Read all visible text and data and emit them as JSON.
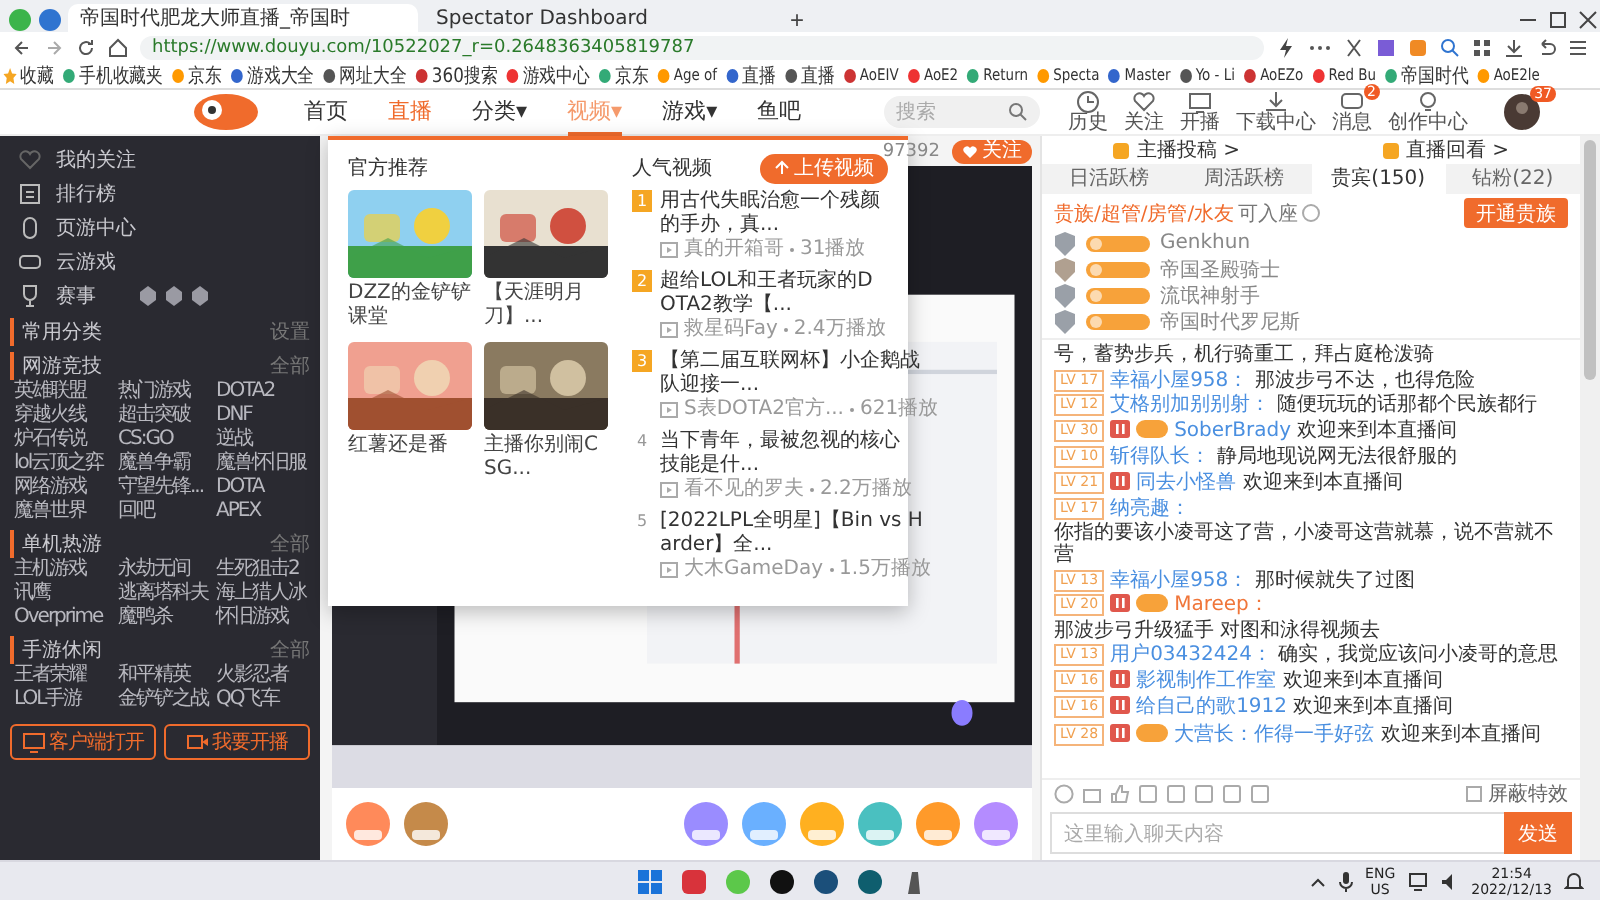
{
  "browser": {
    "tabs": [
      {
        "title": "帝国时代肥龙大师直播_帝国时",
        "selected": true
      },
      {
        "title": "Spectator Dashboard",
        "selected": false
      }
    ],
    "new_tab": "+",
    "url": "https://www.douyu.com/10522027_r=0.2648363405819787",
    "bookmarks": [
      {
        "label": "收藏"
      },
      {
        "label": "手机收藏夹"
      },
      {
        "label": "京东"
      },
      {
        "label": "游戏大全"
      },
      {
        "label": "网址大全"
      },
      {
        "label": "360搜索"
      },
      {
        "label": "游戏中心"
      },
      {
        "label": "京东"
      },
      {
        "label": "Age of"
      },
      {
        "label": "直播"
      },
      {
        "label": "直播"
      },
      {
        "label": "AoEIV"
      },
      {
        "label": "AoE2"
      },
      {
        "label": "Return"
      },
      {
        "label": "Specta"
      },
      {
        "label": "Master"
      },
      {
        "label": "Yo - Li"
      },
      {
        "label": "AoEZo"
      },
      {
        "label": "Red Bu"
      },
      {
        "label": "帝国时代"
      },
      {
        "label": "AoE2le"
      }
    ]
  },
  "site_header": {
    "nav": [
      {
        "label": "首页",
        "selected": false,
        "open": false
      },
      {
        "label": "直播",
        "selected": true,
        "open": false
      },
      {
        "label": "分类",
        "caret": "▾",
        "selected": false,
        "open": false
      },
      {
        "label": "视频",
        "caret": "▾",
        "selected": false,
        "open": true
      },
      {
        "label": "游戏",
        "caret": "▾",
        "selected": false,
        "open": false
      },
      {
        "label": "鱼吧",
        "selected": false,
        "open": false
      }
    ],
    "search": {
      "placeholder": "搜索"
    },
    "actions": [
      {
        "label": "历史",
        "kind": "clock"
      },
      {
        "label": "关注",
        "kind": "heart"
      },
      {
        "label": "开播",
        "kind": "screen"
      },
      {
        "label": "下载中心",
        "kind": "download"
      },
      {
        "label": "消息",
        "kind": "bell",
        "badge": "2"
      },
      {
        "label": "创作中心",
        "kind": "bulb"
      }
    ],
    "avatar_badge": "37"
  },
  "sidebar": {
    "items": [
      {
        "label": "我的关注",
        "kind": "heart"
      },
      {
        "label": "排行榜",
        "kind": "list"
      },
      {
        "label": "页游中心",
        "kind": "mouse"
      },
      {
        "label": "云游戏",
        "kind": "gamepad"
      },
      {
        "label": "赛事",
        "kind": "trophy"
      }
    ],
    "common": {
      "title": "常用分类",
      "action": "设置"
    },
    "groups": [
      {
        "title": "网游竞技",
        "more": "全部",
        "items": [
          "英雄联盟",
          "热门游戏",
          "DOTA2",
          "穿越火线",
          "超击突破",
          "DNF",
          "炉石传说",
          "CS:GO",
          "逆战",
          "lol云顶之弈",
          "魔兽争霸",
          "魔兽怀旧服",
          "网络游戏",
          "守望先锋...",
          "DOTA",
          "魔兽世界",
          "回吧",
          "APEX"
        ]
      },
      {
        "title": "单机热游",
        "more": "全部",
        "items": [
          "主机游戏",
          "永劫无间",
          "生死狙击2",
          "讯鹰",
          "逃离塔科夫",
          "海上猎人冰",
          "Overprime",
          "魔鸭杀",
          "怀旧游戏"
        ]
      },
      {
        "title": "手游休闲",
        "more": "全部",
        "items": [
          "王者荣耀",
          "和平精英",
          "火影忍者",
          "LOL手游",
          "金铲铲之战",
          "QQ飞车"
        ]
      }
    ],
    "buttons": [
      {
        "label": "客户端打开",
        "kind": "monitor"
      },
      {
        "label": "我要开播",
        "kind": "camera"
      }
    ]
  },
  "stream": {
    "viewers": "97392",
    "follow": "关注"
  },
  "nav_menu": {
    "featured_title": "官方推荐",
    "featured": [
      {
        "caption": "DZZ的金铲铲课堂"
      },
      {
        "caption": "【天涯明月刀】..."
      },
      {
        "caption": "红薯还是番"
      },
      {
        "caption": "主播你别闹CSG..."
      }
    ],
    "popular_title": "人气视频",
    "upload": "上传视频",
    "popular": [
      {
        "rank": "1",
        "top": true,
        "title": "用古代失眠治愈一个残颜的手办，真...",
        "author": "真的开箱哥",
        "plays": "31播放"
      },
      {
        "rank": "2",
        "top": true,
        "title": "超给LOL和王者玩家的DOTA2教学【...",
        "author": "救星码Fay",
        "plays": "2.4万播放"
      },
      {
        "rank": "3",
        "top": true,
        "title": "【第二届互联网杯】小企鹅战队迎接一...",
        "author": "S表DOTA2官方...",
        "plays": "621播放"
      },
      {
        "rank": "4",
        "top": false,
        "title": "当下青年，最被忽视的核心技能是什...",
        "author": "看不见的罗夫",
        "plays": "2.2万播放"
      },
      {
        "rank": "5",
        "top": false,
        "title": "[2022LPL全明星]【Bin vs Harder】全...",
        "author": "大木GameDay",
        "plays": "1.5万播放"
      }
    ]
  },
  "chat": {
    "links": [
      {
        "label": "主播投稿 >"
      },
      {
        "label": "直播回看 >"
      }
    ],
    "tabs": [
      {
        "label": "日活跃榜",
        "selected": false
      },
      {
        "label": "周活跃榜",
        "selected": false
      },
      {
        "label": "贵宾(150)",
        "selected": true
      },
      {
        "label": "钻粉(22)",
        "selected": false
      }
    ],
    "guests": {
      "roles": "贵族/超管/房管/水友",
      "note": "可入座",
      "button": "开通贵族",
      "users": [
        {
          "name": "Genkhun"
        },
        {
          "name": "帝国圣殿骑士"
        },
        {
          "name": "流氓神射手"
        },
        {
          "name": "帝国时代罗尼斯"
        }
      ]
    },
    "messages": [
      {
        "hi": false,
        "noble": false,
        "text": "号，蓄势步兵，机行骑重工，拜占庭枪泼骑"
      },
      {
        "level": "LV 17",
        "hi": false,
        "noble": false,
        "user": "幸福小屋958：",
        "color": "#4a8fe0",
        "text": "那波步弓不达，也得危险"
      },
      {
        "level": "LV 12",
        "hi": false,
        "noble": false,
        "user": "艾格别加别别射：",
        "color": "#4a8fe0",
        "text": "随便玩玩的话那都个民族都行"
      },
      {
        "level": "LV 30",
        "hi": true,
        "noble": true,
        "user": "SoberBrady",
        "color": "#4a8fe0",
        "text": "欢迎来到本直播间"
      },
      {
        "level": "LV 10",
        "hi": false,
        "noble": false,
        "user": "斩得队长：",
        "color": "#4a8fe0",
        "text": "静局地现说网无法很舒服的"
      },
      {
        "level": "LV 21",
        "hi": true,
        "noble": false,
        "user": "同去小怪兽",
        "color": "#4a8fe0",
        "text": "欢迎来到本直播间"
      },
      {
        "level": "LV 17",
        "hi": false,
        "noble": false,
        "user": "纳亮趣：",
        "color": "#4a8fe0",
        "text": "你指的要该小凌哥这了营，小凌哥这营就慕，说不营就不营"
      },
      {
        "level": "LV 13",
        "hi": false,
        "noble": false,
        "user": "幸福小屋958：",
        "color": "#4a8fe0",
        "text": "那时候就失了过图"
      },
      {
        "level": "LV 20",
        "hi": true,
        "noble": true,
        "user": "Mareep：",
        "color": "#f0763a",
        "text": "那波步弓升级猛手 对图和泳得视频去"
      },
      {
        "level": "LV 13",
        "hi": false,
        "noble": false,
        "user": "用户03432424：",
        "color": "#4a8fe0",
        "text": "确实，我觉应该问小凌哥的意思"
      },
      {
        "level": "LV 16",
        "hi": true,
        "noble": false,
        "user": "影视制作工作室",
        "color": "#4a8fe0",
        "text": "欢迎来到本直播间"
      },
      {
        "level": "LV 16",
        "hi": true,
        "noble": false,
        "user": "给自己的歌1912",
        "color": "#4a8fe0",
        "text": "欢迎来到本直播间"
      },
      {
        "level": "LV 28",
        "hi": true,
        "noble": true,
        "user": "大营长：作得一手好弦",
        "color": "#4a8fe0",
        "text": "欢迎来到本直播间"
      }
    ],
    "block_effects": {
      "label": "屏蔽特效",
      "checked": false
    },
    "input": {
      "placeholder": "这里输入聊天内容"
    },
    "send": "发送"
  },
  "taskbar": {
    "lang": "ENG",
    "region": "US",
    "time": "21:54",
    "date": "2022/12/13"
  }
}
